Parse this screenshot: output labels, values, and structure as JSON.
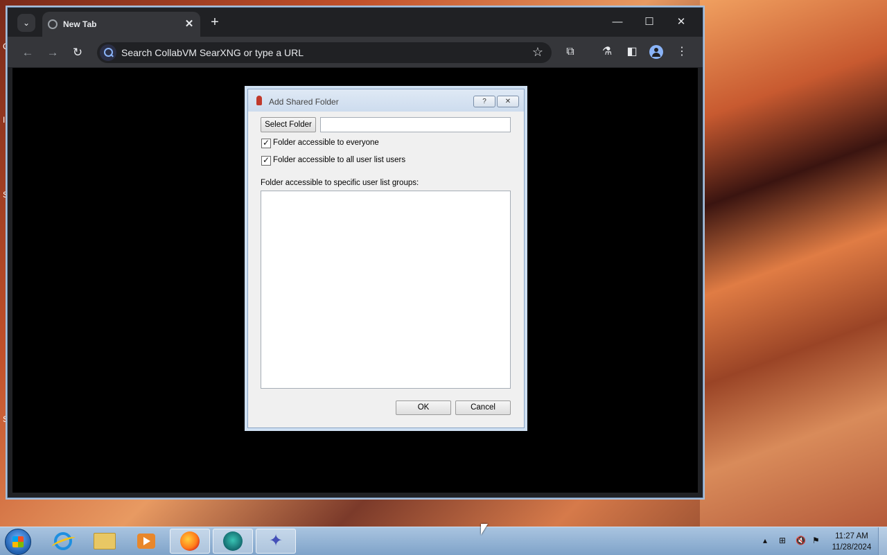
{
  "desktop": {
    "edge_letters": [
      "C",
      "I",
      "S",
      "S"
    ]
  },
  "browser": {
    "tab": {
      "title": "New Tab",
      "close_icon": "✕"
    },
    "new_tab_icon": "+",
    "window_controls": {
      "minimize": "—",
      "maximize": "☐",
      "close": "✕"
    },
    "nav": {
      "back": "←",
      "forward": "→",
      "reload": "↻"
    },
    "omnibox": {
      "placeholder": "Search CollabVM SearXNG or type a URL",
      "star": "☆"
    },
    "toolbar_icons": {
      "extensions": "⧉",
      "labs": "⚗",
      "sidepanel": "◧",
      "menu": "⋮"
    }
  },
  "dialog": {
    "title": "Add Shared Folder",
    "help_button": "?",
    "close_button": "✕",
    "select_folder_label": "Select Folder",
    "folder_path_value": "",
    "checkbox_everyone": {
      "label": "Folder accessible to everyone",
      "checked": true
    },
    "checkbox_all_users": {
      "label": "Folder accessible to all user list users",
      "checked": true
    },
    "groups_label": "Folder accessible to specific user list groups:",
    "groups_items": [],
    "ok_label": "OK",
    "cancel_label": "Cancel"
  },
  "taskbar": {
    "apps": [
      "internet-explorer",
      "windows-explorer",
      "media-player",
      "firefox",
      "free-download-manager",
      "collabvm-client"
    ],
    "tray": {
      "chevron": "▴",
      "network": "⊞",
      "volume_muted": "🔇",
      "flag": "⚑"
    },
    "clock": {
      "time": "11:27 AM",
      "date": "11/28/2024"
    }
  }
}
